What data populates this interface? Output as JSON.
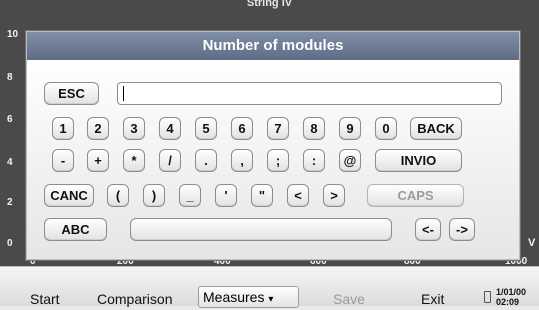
{
  "plot": {
    "title": "String IV",
    "y_ticks": [
      "10",
      "8",
      "6",
      "4",
      "2",
      "0"
    ],
    "x_ticks": [
      "0",
      "200",
      "400",
      "600",
      "800",
      "1000"
    ],
    "x_unit": "V"
  },
  "dialog": {
    "title": "Number of modules",
    "input_value": "",
    "keys": {
      "esc": "ESC",
      "row1": [
        "1",
        "2",
        "3",
        "4",
        "5",
        "6",
        "7",
        "8",
        "9",
        "0",
        "BACK"
      ],
      "row2": [
        "-",
        "+",
        "*",
        "/",
        ".",
        ",",
        ";",
        ":",
        "@",
        "INVIO"
      ],
      "row3": [
        "CANC",
        "(",
        ")",
        "_",
        "'",
        "\"",
        "<",
        ">",
        "CAPS"
      ],
      "abc": "ABC",
      "space": "",
      "left": "<-",
      "right": "->"
    }
  },
  "toolbar": {
    "start": "Start",
    "comparison": "Comparison",
    "measures": "Measures",
    "measures_caret": "▾",
    "save": "Save",
    "exit": "Exit",
    "date": "1/01/00",
    "time": "02:09"
  },
  "icons": {
    "status": "battery-icon"
  }
}
